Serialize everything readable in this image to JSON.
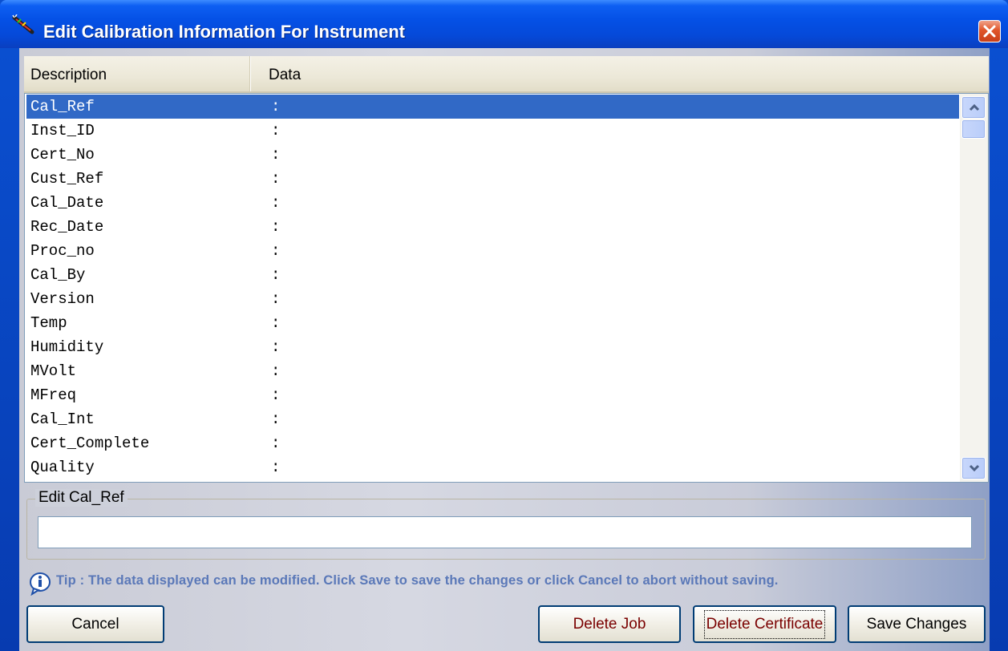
{
  "window": {
    "title": "Edit Calibration Information For Instrument",
    "icon": "calibration-tool-icon",
    "close_icon": "close-icon"
  },
  "list": {
    "columns": [
      "Description",
      "Data"
    ],
    "rows": [
      {
        "desc": "Cal_Ref",
        "val": ":"
      },
      {
        "desc": "Inst_ID",
        "val": ":"
      },
      {
        "desc": "Cert_No",
        "val": ":"
      },
      {
        "desc": "Cust_Ref",
        "val": ":"
      },
      {
        "desc": "Cal_Date",
        "val": ":"
      },
      {
        "desc": "Rec_Date",
        "val": ":"
      },
      {
        "desc": "Proc_no",
        "val": ":"
      },
      {
        "desc": "Cal_By",
        "val": ":"
      },
      {
        "desc": "Version",
        "val": ":"
      },
      {
        "desc": "Temp",
        "val": ":"
      },
      {
        "desc": "Humidity",
        "val": ":"
      },
      {
        "desc": "MVolt",
        "val": ":"
      },
      {
        "desc": "MFreq",
        "val": ":"
      },
      {
        "desc": "Cal_Int",
        "val": ":"
      },
      {
        "desc": "Cert_Complete",
        "val": ":"
      },
      {
        "desc": "Quality",
        "val": ":"
      }
    ],
    "selected_index": 0,
    "selection_color": "#3169c6"
  },
  "edit": {
    "group_label": "Edit Cal_Ref",
    "value": ""
  },
  "tip": {
    "icon": "info-icon",
    "text": "Tip : The data displayed can be modified. Click Save to save the changes or click Cancel to abort without saving."
  },
  "buttons": {
    "cancel": "Cancel",
    "delete_job": "Delete Job",
    "delete_certificate": "Delete Certificate",
    "save_changes": "Save Changes"
  },
  "colors": {
    "titlebar": "#0551e6",
    "delete_text": "#7a0000"
  }
}
